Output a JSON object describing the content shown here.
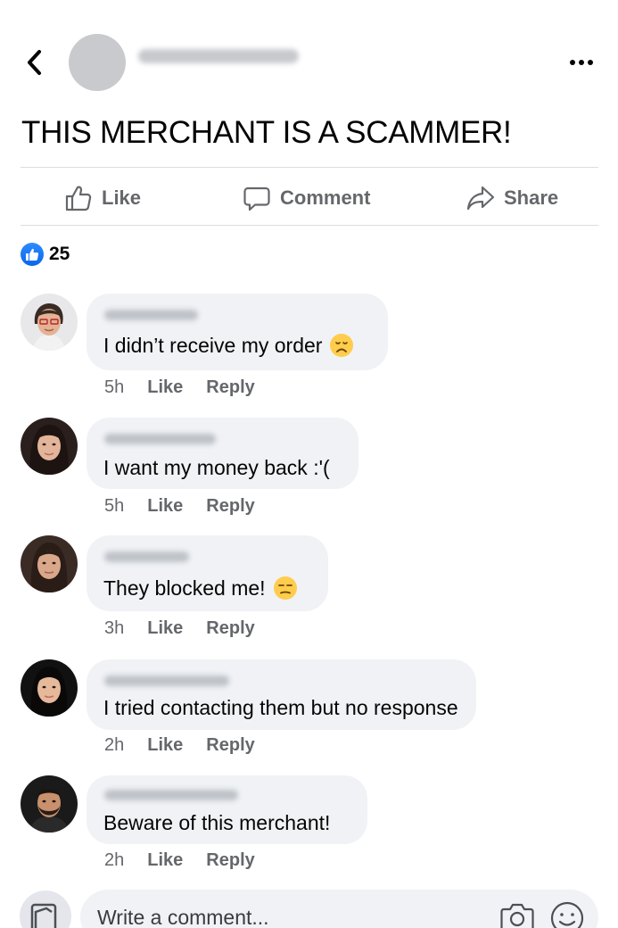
{
  "header": {
    "back_icon": "chevron-left-icon",
    "more_icon": "ellipsis-icon"
  },
  "post": {
    "text": "THIS MERCHANT IS A SCAMMER!"
  },
  "actions": {
    "like_label": "Like",
    "comment_label": "Comment",
    "share_label": "Share"
  },
  "reactions": {
    "count": "25",
    "icon": "like-reaction-icon",
    "color": "#1877f2"
  },
  "comments": [
    {
      "text": "I didn’t receive my order",
      "emoji": "disappointed-face-emoji",
      "time": "5h",
      "like": "Like",
      "reply": "Reply"
    },
    {
      "text": "I want my money back :'(",
      "emoji": "",
      "time": "5h",
      "like": "Like",
      "reply": "Reply"
    },
    {
      "text": "They blocked me!",
      "emoji": "unamused-face-emoji",
      "time": "3h",
      "like": "Like",
      "reply": "Reply"
    },
    {
      "text": "I tried contacting them but no response",
      "emoji": "",
      "time": "2h",
      "like": "Like",
      "reply": "Reply"
    },
    {
      "text": "Beware of this merchant!",
      "emoji": "",
      "time": "2h",
      "like": "Like",
      "reply": "Reply"
    }
  ],
  "composer": {
    "placeholder": "Write a comment..."
  },
  "colors": {
    "secondary_text": "#65676b",
    "bubble_bg": "#f0f2f5",
    "divider": "#dadde1"
  }
}
